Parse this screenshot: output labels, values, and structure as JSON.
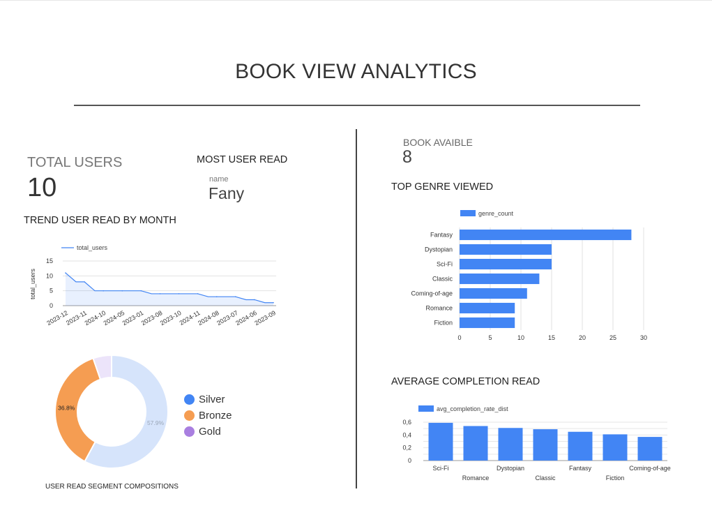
{
  "page": {
    "title": "BOOK VIEW ANALYTICS"
  },
  "kpis": {
    "total_users": {
      "label": "TOTAL USERS",
      "value": "10"
    },
    "most_user_read": {
      "title": "MOST USER READ",
      "field": "name",
      "value": "Fany"
    },
    "book_available": {
      "label": "BOOK AVAIBLE",
      "value": "8"
    }
  },
  "sections": {
    "trend": "TREND USER READ BY MONTH",
    "genre": "TOP GENRE VIEWED",
    "completion": "AVERAGE COMPLETION READ",
    "segment": "USER READ SEGMENT COMPOSITIONS"
  },
  "colors": {
    "primary": "#4285f4",
    "bronze": "#f59d52",
    "silver_fill": "#d6e4fb",
    "gold": "#a97fe0",
    "gold_fill": "#ece4fa"
  },
  "chart_data": [
    {
      "id": "trend",
      "type": "area",
      "legend": "total_users",
      "ylabel": "total_users",
      "ylim": [
        0,
        15
      ],
      "yticks": [
        0,
        5,
        10,
        15
      ],
      "x": [
        "2023-12",
        "2023-11",
        "2024-10",
        "2024-05",
        "2023-01",
        "2023-08",
        "2023-10",
        "2024-11",
        "2024-08",
        "2023-07",
        "2024-06",
        "2023-09"
      ],
      "values": [
        11,
        8,
        5,
        5,
        5,
        4,
        4,
        4,
        3,
        3,
        2,
        1
      ]
    },
    {
      "id": "genre",
      "type": "bar",
      "orientation": "horizontal",
      "legend": "genre_count",
      "categories": [
        "Fantasy",
        "Dystopian",
        "Sci-Fi",
        "Classic",
        "Coming-of-age",
        "Romance",
        "Fiction"
      ],
      "values": [
        28,
        15,
        15,
        13,
        11,
        9,
        9
      ],
      "xlim": [
        0,
        30
      ],
      "xticks": [
        0,
        5,
        10,
        15,
        20,
        25,
        30
      ]
    },
    {
      "id": "completion",
      "type": "bar",
      "legend": "avg_completion_rate_dist",
      "categories": [
        "Sci-Fi",
        "Romance",
        "Dystopian",
        "Classic",
        "Fantasy",
        "Fiction",
        "Coming-of-age"
      ],
      "values": [
        0.59,
        0.54,
        0.51,
        0.49,
        0.45,
        0.41,
        0.37
      ],
      "ylim": [
        0,
        0.6
      ],
      "yticks": [
        "0",
        "0,2",
        "0,4",
        "0,6"
      ]
    },
    {
      "id": "segment",
      "type": "pie",
      "labels": [
        "Silver",
        "Bronze",
        "Gold"
      ],
      "values": [
        57.9,
        36.8,
        5.3
      ],
      "shown_labels": [
        "57.9%",
        "36.8%",
        ""
      ]
    }
  ]
}
